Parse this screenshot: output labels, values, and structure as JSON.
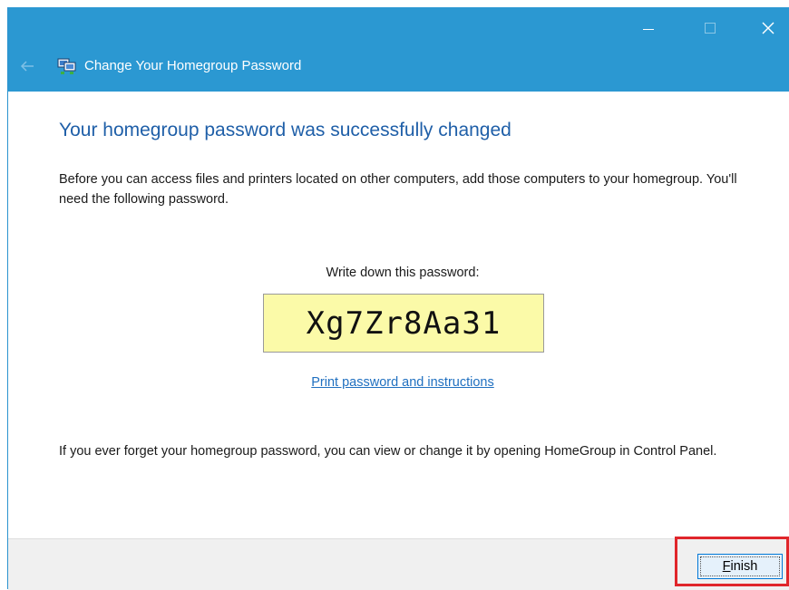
{
  "window": {
    "title": "Change Your Homegroup Password",
    "title_icon": "homegroup-network-icon",
    "back_icon": "back-arrow-icon",
    "caption_buttons": [
      "minimize-icon",
      "maximize-icon",
      "close-icon"
    ],
    "close_glyph": "✕",
    "accent_color": "#2b98d2"
  },
  "content": {
    "heading": "Your homegroup password was successfully changed",
    "intro": "Before you can access files and printers located on other computers, add those computers to your homegroup. You'll need the following password.",
    "write_down_label": "Write down this password:",
    "password": "Xg7Zr8Aa31",
    "print_link": "Print password and instructions",
    "forget_note": "If you ever forget your homegroup password, you can view or change it by opening HomeGroup in Control Panel."
  },
  "footer": {
    "finish_label_accel": "F",
    "finish_label_rest": "inish",
    "highlight_color": "#e0262b"
  }
}
